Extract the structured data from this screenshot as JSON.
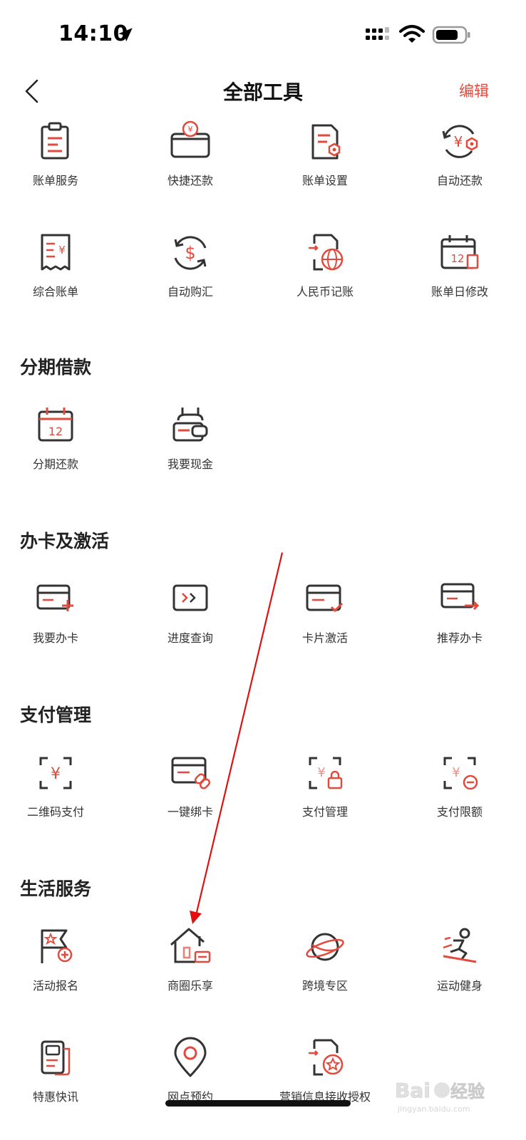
{
  "status": {
    "time": "14:10"
  },
  "nav": {
    "title": "全部工具",
    "edit_label": "编辑"
  },
  "sections": {
    "bill": {
      "row1": [
        "账单服务",
        "快捷还款",
        "账单设置",
        "自动还款"
      ],
      "row2": [
        "综合账单",
        "自动购汇",
        "人民币记账",
        "账单日修改"
      ]
    },
    "installment": {
      "title": "分期借款",
      "items": [
        "分期还款",
        "我要现金"
      ]
    },
    "card": {
      "title": "办卡及激活",
      "items": [
        "我要办卡",
        "进度查询",
        "卡片激活",
        "推荐办卡"
      ]
    },
    "payment": {
      "title": "支付管理",
      "items": [
        "二维码支付",
        "一键绑卡",
        "支付管理",
        "支付限额"
      ]
    },
    "life": {
      "title": "生活服务",
      "row1": [
        "活动报名",
        "商圈乐享",
        "跨境专区",
        "运动健身"
      ],
      "row2": [
        "特惠快讯",
        "网点预约",
        "营销信息接收授权"
      ]
    }
  },
  "watermark": {
    "brand": "Baidu经验",
    "site": "jingyan.baidu.com"
  },
  "colors": {
    "accent": "#e14a3c",
    "icon_stroke": "#333333",
    "arrow": "#e01010"
  }
}
